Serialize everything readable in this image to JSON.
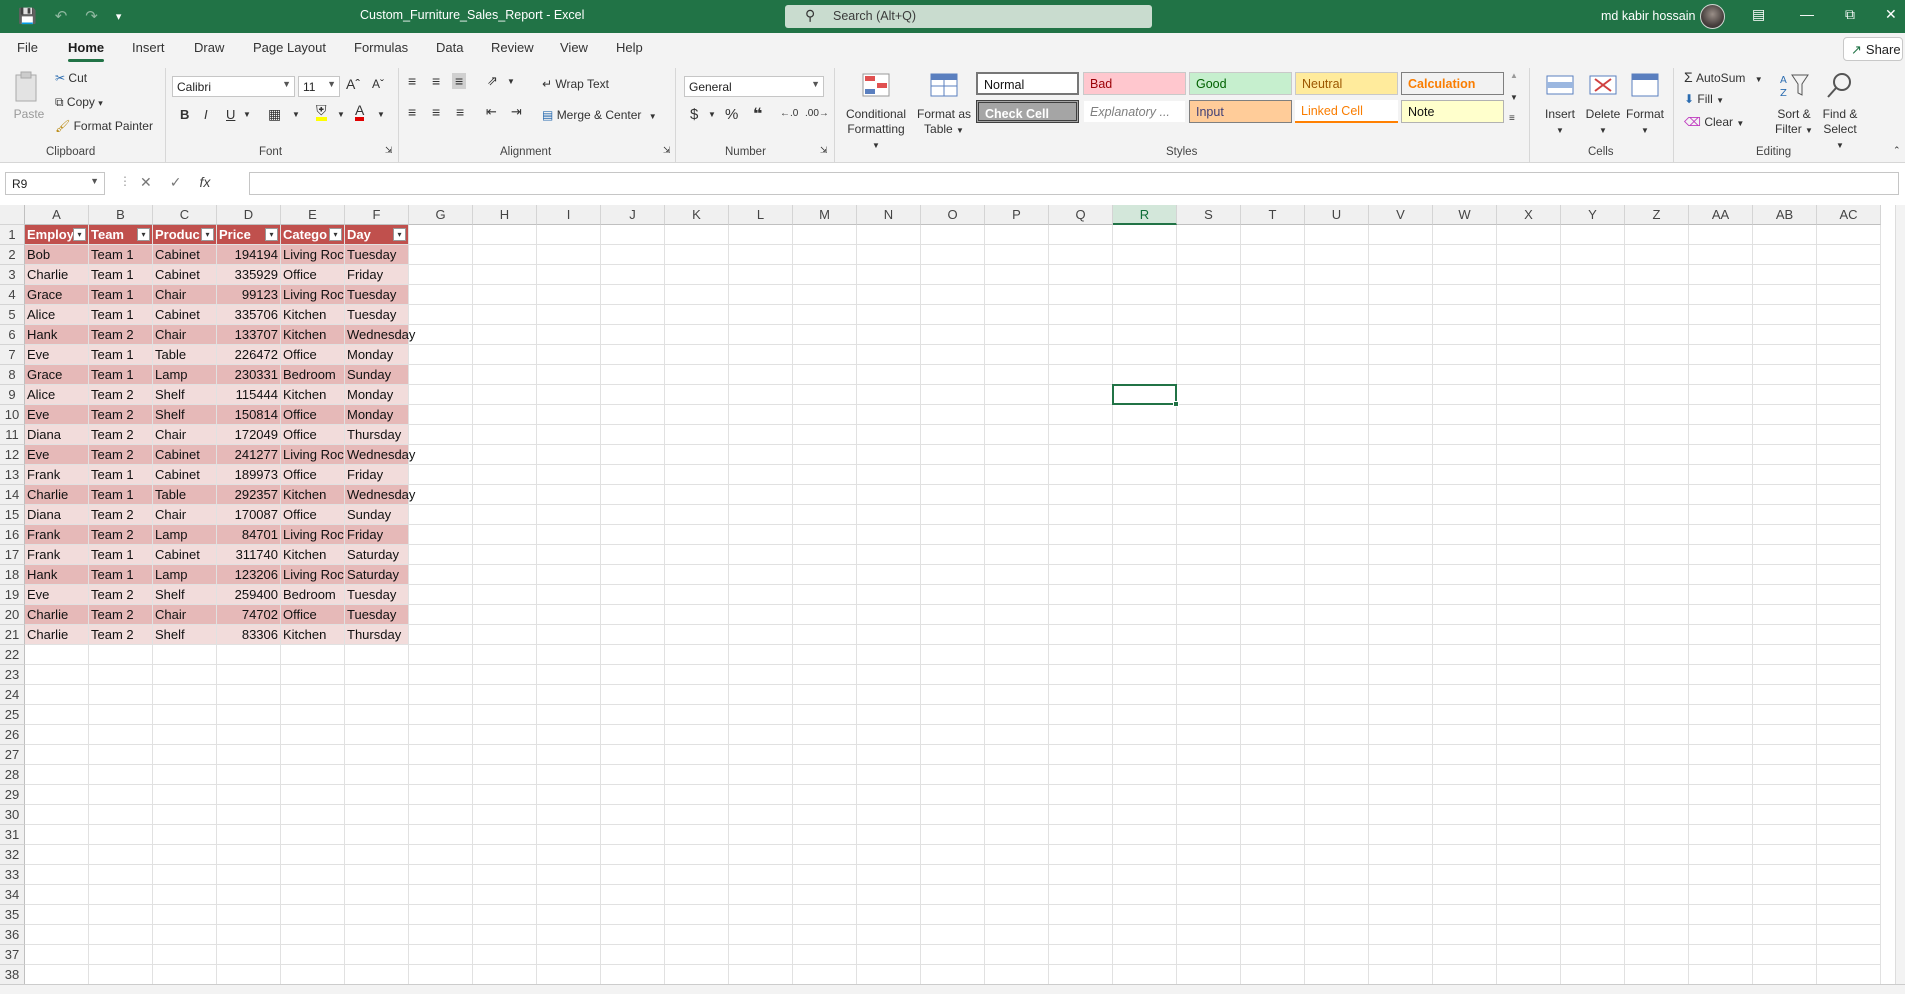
{
  "window": {
    "title": "Custom_Furniture_Sales_Report - Excel",
    "search_placeholder": "Search (Alt+Q)",
    "user": "md kabir hossain"
  },
  "tabs": [
    "File",
    "Home",
    "Insert",
    "Draw",
    "Page Layout",
    "Formulas",
    "Data",
    "Review",
    "View",
    "Help"
  ],
  "active_tab": "Home",
  "share_label": "Share",
  "ribbon": {
    "clipboard": {
      "paste": "Paste",
      "cut": "Cut",
      "copy": "Copy",
      "format_painter": "Format Painter",
      "label": "Clipboard"
    },
    "font": {
      "name": "Calibri",
      "size": "11",
      "label": "Font"
    },
    "alignment": {
      "wrap_text": "Wrap Text",
      "merge_center": "Merge & Center",
      "label": "Alignment"
    },
    "number": {
      "format": "General",
      "label": "Number"
    },
    "styles": {
      "conditional": [
        "Conditional",
        "Formatting"
      ],
      "format_table": [
        "Format as",
        "Table"
      ],
      "normal": "Normal",
      "bad": "Bad",
      "good": "Good",
      "neutral": "Neutral",
      "calculation": "Calculation",
      "check_cell": "Check Cell",
      "explanatory": "Explanatory ...",
      "input": "Input",
      "linked_cell": "Linked Cell",
      "note": "Note",
      "label": "Styles"
    },
    "cells": {
      "insert": "Insert",
      "delete": "Delete",
      "format": "Format",
      "label": "Cells"
    },
    "editing": {
      "autosum": "AutoSum",
      "fill": "Fill",
      "clear": "Clear",
      "sort_filter": [
        "Sort &",
        "Filter"
      ],
      "find_select": [
        "Find &",
        "Select"
      ],
      "label": "Editing"
    }
  },
  "formula_bar": {
    "name_box": "R9",
    "formula": ""
  },
  "sheet": {
    "columns": [
      "A",
      "B",
      "C",
      "D",
      "E",
      "F",
      "G",
      "H",
      "I",
      "J",
      "K",
      "L",
      "M",
      "N",
      "O",
      "P",
      "Q",
      "R",
      "S",
      "T",
      "U",
      "V",
      "W",
      "X",
      "Y",
      "Z",
      "AA",
      "AB",
      "AC"
    ],
    "selected_column": "R",
    "selected_cell": "R9",
    "header_row": [
      "Employ",
      "Team",
      "Produc",
      "Price",
      "Catego",
      "Day"
    ],
    "rows": [
      [
        "Bob",
        "Team 1",
        "Cabinet",
        "194194",
        "Living Roc",
        "Tuesday"
      ],
      [
        "Charlie",
        "Team 1",
        "Cabinet",
        "335929",
        "Office",
        "Friday"
      ],
      [
        "Grace",
        "Team 1",
        "Chair",
        "99123",
        "Living Roc",
        "Tuesday"
      ],
      [
        "Alice",
        "Team 1",
        "Cabinet",
        "335706",
        "Kitchen",
        "Tuesday"
      ],
      [
        "Hank",
        "Team 2",
        "Chair",
        "133707",
        "Kitchen",
        "Wednesday"
      ],
      [
        "Eve",
        "Team 1",
        "Table",
        "226472",
        "Office",
        "Monday"
      ],
      [
        "Grace",
        "Team 1",
        "Lamp",
        "230331",
        "Bedroom",
        "Sunday"
      ],
      [
        "Alice",
        "Team 2",
        "Shelf",
        "115444",
        "Kitchen",
        "Monday"
      ],
      [
        "Eve",
        "Team 2",
        "Shelf",
        "150814",
        "Office",
        "Monday"
      ],
      [
        "Diana",
        "Team 2",
        "Chair",
        "172049",
        "Office",
        "Thursday"
      ],
      [
        "Eve",
        "Team 2",
        "Cabinet",
        "241277",
        "Living Roc",
        "Wednesday"
      ],
      [
        "Frank",
        "Team 1",
        "Cabinet",
        "189973",
        "Office",
        "Friday"
      ],
      [
        "Charlie",
        "Team 1",
        "Table",
        "292357",
        "Kitchen",
        "Wednesday"
      ],
      [
        "Diana",
        "Team 2",
        "Chair",
        "170087",
        "Office",
        "Sunday"
      ],
      [
        "Frank",
        "Team 2",
        "Lamp",
        "84701",
        "Living Roc",
        "Friday"
      ],
      [
        "Frank",
        "Team 1",
        "Cabinet",
        "311740",
        "Kitchen",
        "Saturday"
      ],
      [
        "Hank",
        "Team 1",
        "Lamp",
        "123206",
        "Living Roc",
        "Saturday"
      ],
      [
        "Eve",
        "Team 2",
        "Shelf",
        "259400",
        "Bedroom",
        "Tuesday"
      ],
      [
        "Charlie",
        "Team 2",
        "Chair",
        "74702",
        "Office",
        "Tuesday"
      ],
      [
        "Charlie",
        "Team 2",
        "Shelf",
        "83306",
        "Kitchen",
        "Thursday"
      ]
    ],
    "visible_row_count": 38
  },
  "colors": {
    "brand": "#217346",
    "table_header": "#c0504d",
    "band_dark": "#e6b9b8",
    "band_light": "#f2dcdb"
  }
}
